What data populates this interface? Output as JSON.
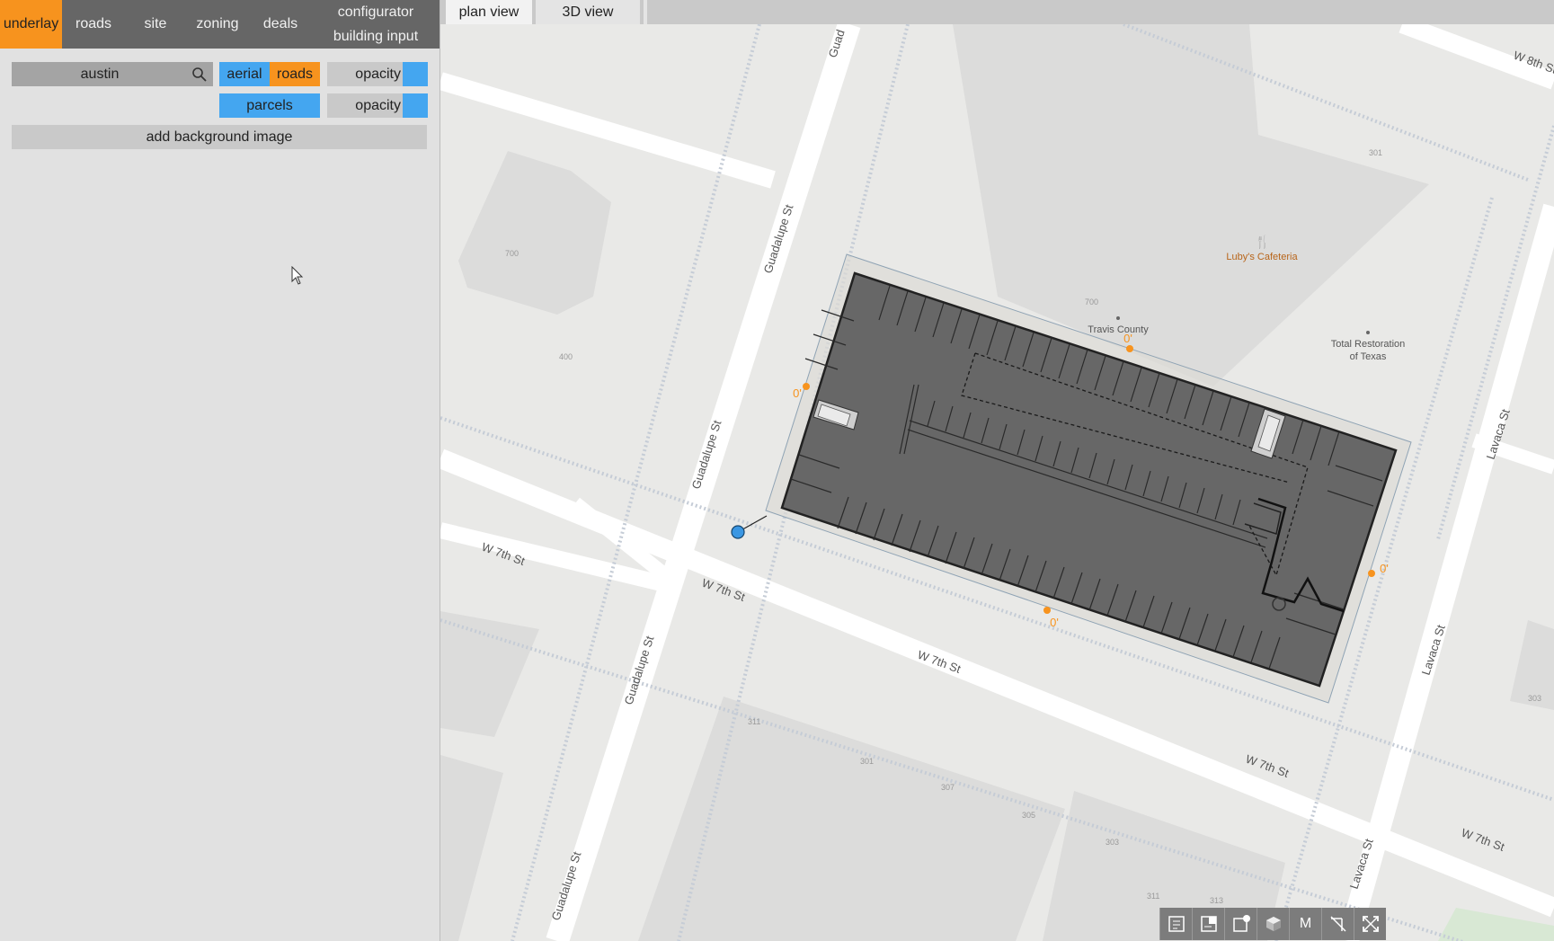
{
  "nav": {
    "items": [
      "underlay",
      "roads",
      "site",
      "zoning",
      "deals"
    ],
    "configurator": "configurator",
    "building_input": "building input"
  },
  "underlay": {
    "search_value": "austin",
    "aerial": "aerial",
    "roads": "roads",
    "parcels": "parcels",
    "opacity1": "opacity",
    "opacity2": "opacity",
    "add_bg": "add background image"
  },
  "tabs": {
    "plan": "plan view",
    "three_d": "3D view"
  },
  "map": {
    "streets": {
      "guad1": "Guadalupe St",
      "guad2": "Guadalupe St",
      "guad3": "Guadalupe St",
      "guad4": "Guadalupe St",
      "guad_top": "Guad",
      "w7_1": "W 7th St",
      "w7_2": "W 7th St",
      "w7_3": "W 7th St",
      "w7_4": "W 7th St",
      "w7_5": "W 7th St",
      "lavaca1": "Lavaca St",
      "lavaca2": "Lavaca St",
      "lavaca3": "Lavaca St",
      "w8": "W 8th St"
    },
    "pois": {
      "lubys": "Luby's Cafeteria",
      "travis": "Travis County",
      "total1": "Total Restoration",
      "total2": "of Texas"
    },
    "numbers": {
      "n700a": "700",
      "n400": "400",
      "n700b": "700",
      "n301": "301",
      "n311a": "311",
      "n301b": "301",
      "n307": "307",
      "n305": "305",
      "n303": "303",
      "n311b": "311",
      "n313": "313",
      "n303b": "303"
    },
    "setbacks": {
      "top": "0'",
      "left": "0'",
      "right": "0'",
      "bottom": "0'"
    }
  },
  "toolbar": {
    "m": "M"
  },
  "colors": {
    "accent": "#f7931e",
    "blue": "#44a6f0",
    "nav": "#666666",
    "building": "#676767"
  }
}
